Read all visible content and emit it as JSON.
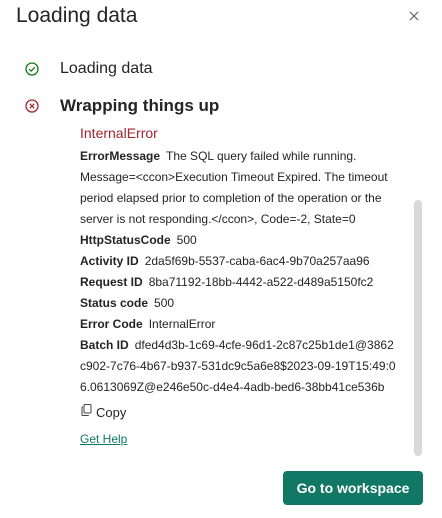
{
  "dialog": {
    "title": "Loading data",
    "close_icon": "close-icon"
  },
  "steps": [
    {
      "label": "Loading data",
      "status": "success",
      "icon": "check-circle-icon",
      "color": "#107c10"
    },
    {
      "label": "Wrapping things up",
      "status": "error",
      "icon": "error-circle-icon",
      "color": "#a4262c"
    }
  ],
  "error": {
    "title": "InternalError",
    "message_label": "ErrorMessage",
    "message_value": "The SQL query failed while running. Message=<ccon>Execution Timeout Expired. The timeout period elapsed prior to completion of the operation or the server is not responding.</ccon>, Code=-2, State=0",
    "http_label": "HttpStatusCode",
    "http_value": "500",
    "activity_label": "Activity ID",
    "activity_value": "2da5f69b-5537-caba-6ac4-9b70a257aa96",
    "request_label": "Request ID",
    "request_value": "8ba71192-18bb-4442-a522-d489a5150fc2",
    "status_label": "Status code",
    "status_value": "500",
    "code_label": "Error Code",
    "code_value": "InternalError",
    "batch_label": "Batch ID",
    "batch_value": "dfed4d3b-1c69-4cfe-96d1-2c87c25b1de1@3862c902-7c76-4b67-b937-531dc9c5a6e8$2023-09-19T15:49:06.0613069Z@e246e50c-d4e4-4adb-bed6-38bb41ce536b"
  },
  "copy_label": "Copy",
  "help_label": "Get Help",
  "primary_button": "Go to workspace",
  "colors": {
    "accent": "#117865",
    "error": "#a4262c",
    "success": "#107c10"
  }
}
